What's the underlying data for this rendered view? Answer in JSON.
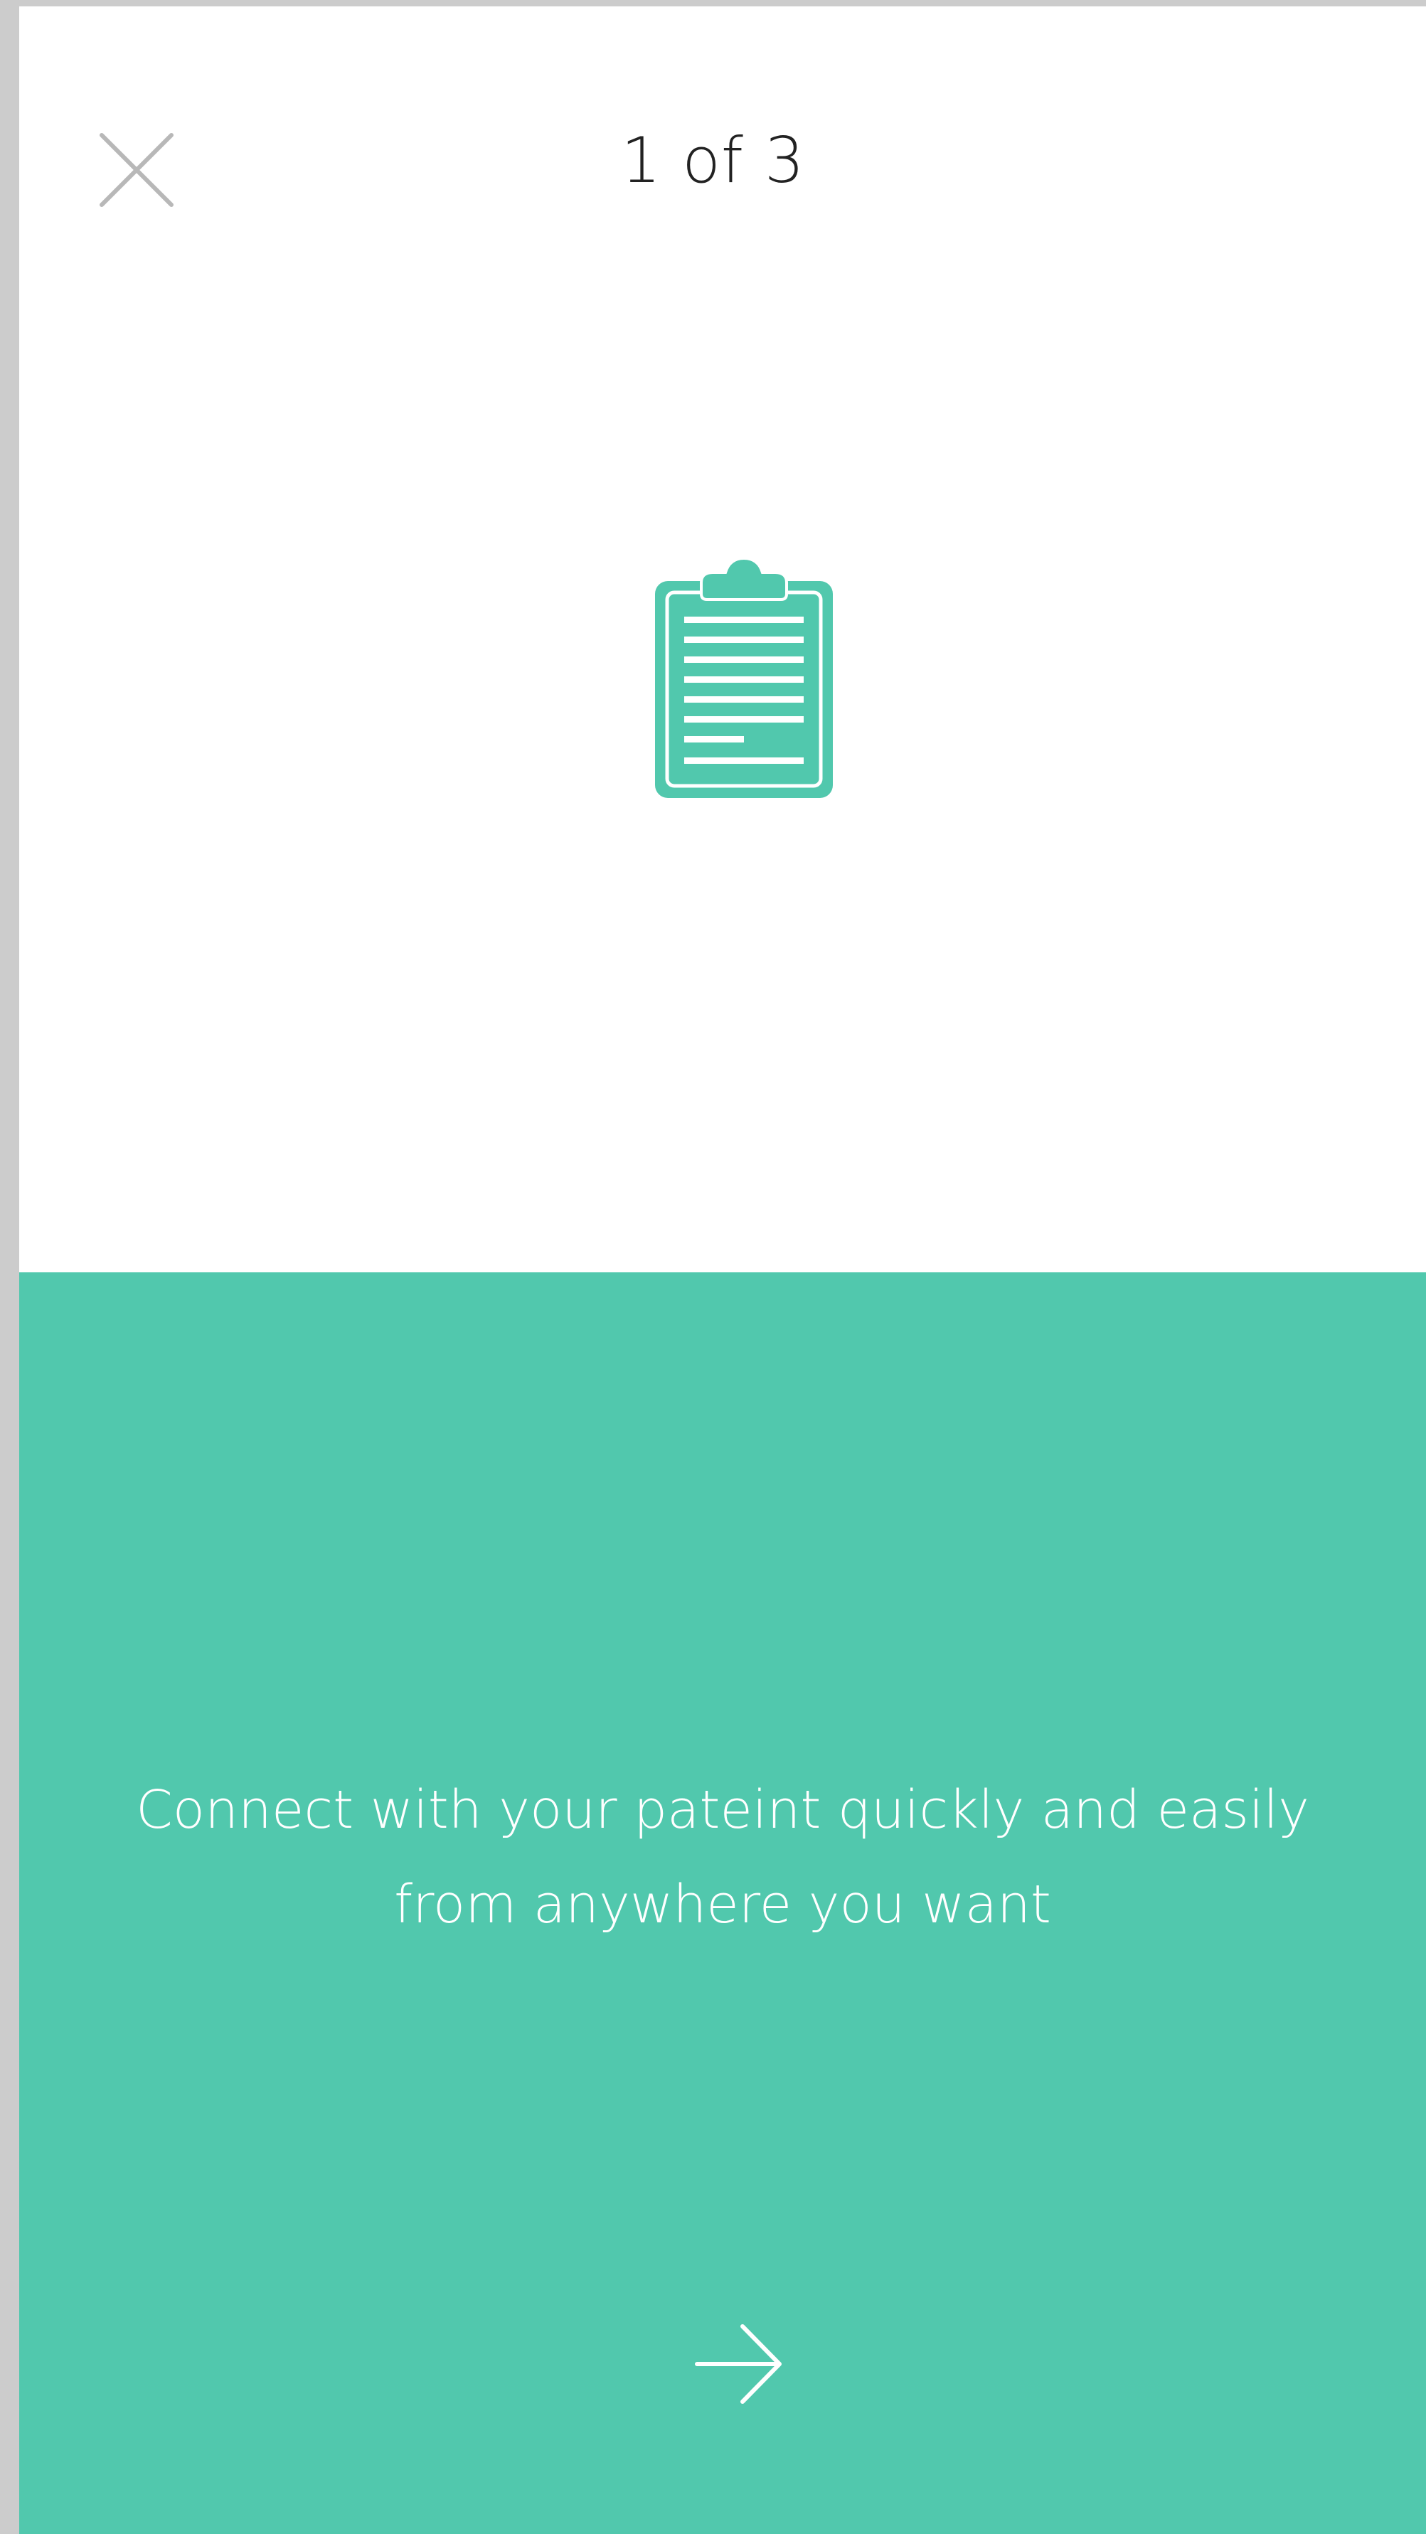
{
  "header": {
    "close_icon": "close-icon",
    "step_label": "1 of 3"
  },
  "hero": {
    "icon": "clipboard-icon",
    "accent_color": "#51c8ad"
  },
  "onboarding": {
    "message_line1": "Connect with your pateint quickly and easily",
    "message_line2": "from anywhere you want",
    "next_icon": "arrow-right-icon",
    "background_color": "#51c8ad"
  },
  "progress": {
    "current_step": 1,
    "total_steps": 3
  }
}
